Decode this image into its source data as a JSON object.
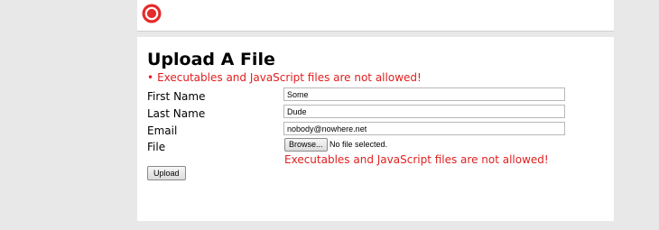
{
  "header": {
    "logo_icon": "red-circle-logo-icon"
  },
  "page": {
    "title": "Upload A File",
    "errors": [
      "Executables and JavaScript files are not allowed!"
    ]
  },
  "form": {
    "first_name_label": "First Name",
    "first_name_value": "Some",
    "last_name_label": "Last Name",
    "last_name_value": "Dude",
    "email_label": "Email",
    "email_value": "nobody@nowhere.net",
    "file_label": "File",
    "browse_label": "Browse...",
    "no_file_text": "No file selected.",
    "file_error": "Executables and JavaScript files are not allowed!",
    "upload_label": "Upload"
  },
  "colors": {
    "error": "#e02020",
    "logo": "#e52b2b"
  }
}
